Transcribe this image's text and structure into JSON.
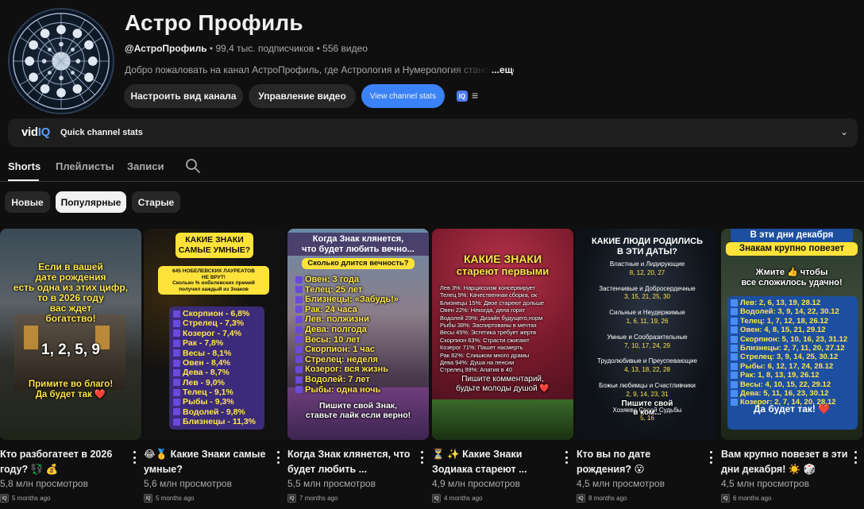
{
  "channel": {
    "title": "Астро Профиль",
    "handle": "@АстроПрофиль",
    "meta": " • 99,4 тыс. подписчиков • 556 видео",
    "description": "Добро пожаловать на канал АстроПрофиль, где Астрология и Нумерология станов",
    "more": "...ещё",
    "buttons": {
      "customize": "Настроить вид канала",
      "manage": "Управление видео",
      "stats": "View channel stats"
    },
    "iq_badge": "IQ"
  },
  "vidiq": {
    "logo_a": "vid",
    "logo_b": "IQ",
    "label": "Quick channel stats"
  },
  "tabs": [
    {
      "label": "Shorts"
    },
    {
      "label": "Плейлисты"
    },
    {
      "label": "Записи"
    }
  ],
  "chips": [
    {
      "label": "Новые"
    },
    {
      "label": "Популярные"
    },
    {
      "label": "Старые"
    }
  ],
  "videos": [
    {
      "title": "Кто разбогатеет в 2026 году? 💱 💰",
      "views": "5,8 млн просмотров",
      "age": "5 months ago",
      "thumb": {
        "lines": [
          "Если в вашей",
          "дате рождения",
          "есть одна из этих цифр,",
          "то в 2026 году",
          "вас ждет",
          "богатство!"
        ],
        "digits": "1, 2, 5, 9",
        "footer": [
          "Примите во благо!",
          "Да будет так ❤️"
        ]
      }
    },
    {
      "title": "😂🥇 Какие Знаки самые умные?",
      "views": "5,6 млн просмотров",
      "age": "5 months ago",
      "thumb": {
        "header": [
          "КАКИЕ ЗНАКИ",
          "САМЫЕ УМНЫЕ?"
        ],
        "sub": [
          "645 НОБЕЛЕВСКИХ ЛАУРЕАТОВ",
          "НЕ ВРУТ!",
          "Сколько % нобелевских премий",
          "получил каждый из Знаков"
        ],
        "list": [
          "Скорпион - 6,8%",
          "Стрелец - 7,3%",
          "Козерог - 7,4%",
          "Рак - 7,8%",
          "Весы - 8,1%",
          "Овен - 8,4%",
          "Дева - 8,7%",
          "Лев - 9,0%",
          "Телец - 9,1%",
          "Рыбы - 9,3%",
          "Водолей - 9,8%",
          "Близнецы - 11,3%"
        ]
      }
    },
    {
      "title": "Когда Знак клянется, что будет любить ...",
      "views": "5,5 млн просмотров",
      "age": "7 months ago",
      "thumb": {
        "header": [
          "Когда Знак клянется,",
          "что будет любить вечно..."
        ],
        "sub": "Сколько длится вечность?",
        "list": [
          "Овен: 3 года",
          "Телец: 25 лет",
          "Близнецы: «Забудь!»",
          "Рак: 24 часа",
          "Лев: полжизни",
          "Дева: полгода",
          "Весы: 10 лет",
          "Скорпион: 1 час",
          "Стрелец: неделя",
          "Козерог: вся жизнь",
          "Водолей: 7 лет",
          "Рыбы: одна ночь"
        ],
        "footer": [
          "Пишите свой Знак,",
          "ставьте лайк если верно!"
        ]
      }
    },
    {
      "title": "⏳ ✨ Какие Знаки Зодиака стареют ...",
      "views": "4,9 млн просмотров",
      "age": "4 months ago",
      "thumb": {
        "header": [
          "КАКИЕ ЗНАКИ",
          "стареют первыми"
        ],
        "list": [
          "Лев 3%: Нарциссизм консервирует",
          "Телец 9%: Качественная сборка, ок",
          "Близнецы 15%: Двое стареют дольше",
          "Овен 22%: Некогда, дела горят",
          "Водолей 29%: Дизайн будущего,норм",
          "Рыбы 38%: Заспиртованы в мечтах",
          "Весы 45%: Эстетика требует жертв",
          "Скорпион 63%: Страсти сжигают",
          "Козерог 71%: Пашет насмерть",
          "Рак 82%: Слишком много драмы",
          "Дева 94%: Душа на пенсии",
          "Стрелец 99%: Апатия в 40"
        ],
        "footer": [
          "Пишите комментарий,",
          "будьте молоды душой ❤️"
        ]
      }
    },
    {
      "title": "Кто вы по дате рождения? 😮",
      "views": "4,5 млн просмотров",
      "age": "8 months ago",
      "thumb": {
        "header": [
          "КАКИЕ ЛЮДИ РОДИЛИСЬ",
          "В ЭТИ ДАТЫ?"
        ],
        "groups": [
          {
            "name": "Властные и Лидирующие",
            "dates": "8, 12, 20, 27"
          },
          {
            "name": "Застенчивые и Добросердечные",
            "dates": "3, 15, 21, 25, 30"
          },
          {
            "name": "Сильные и Неудержимые",
            "dates": "1, 6, 11, 19, 26"
          },
          {
            "name": "Умные и Сообразительные",
            "dates": "7, 10, 17, 24, 29"
          },
          {
            "name": "Трудолюбивые и Преуспевающие",
            "dates": "4, 13, 18, 22, 28"
          },
          {
            "name": "Божьи любимцы и Счастливчики",
            "dates": "2, 9, 14, 23, 31"
          },
          {
            "name": "Хозяева Своей Судьбы",
            "dates": "5, 16"
          }
        ],
        "footer": [
          "Пишите свой",
          "в ком..."
        ]
      }
    },
    {
      "title": "Вам крупно повезет в эти дни декабря! ☀️ 🎲",
      "views": "4,5 млн просмотров",
      "age": "6 months ago",
      "thumb": {
        "header": [
          "В эти дни декабря",
          "Знакам крупно повезет"
        ],
        "sub": [
          "Жмите 👍 чтобы",
          "все сложилось удачно!"
        ],
        "list": [
          "Лев: 2, 6, 13, 19, 28.12",
          "Водолей: 3, 9, 14, 22, 30.12",
          "Телец: 1, 7, 12, 18, 26.12",
          "Овен: 4, 8, 15, 21, 29.12",
          "Скорпион: 5, 10, 16, 23, 31.12",
          "Близнецы: 2, 7, 11, 20, 27.12",
          "Стрелец: 3, 9, 14, 25, 30.12",
          "Рыбы: 6, 12, 17, 24, 28.12",
          "Рак: 1, 8, 13, 19, 26.12",
          "Весы: 4, 10, 15, 22, 29.12",
          "Дева: 5, 11, 16, 23, 30.12",
          "Козерог: 2, 7, 14, 20, 28.12"
        ],
        "footer": "Да будет так! ❤️"
      }
    }
  ]
}
